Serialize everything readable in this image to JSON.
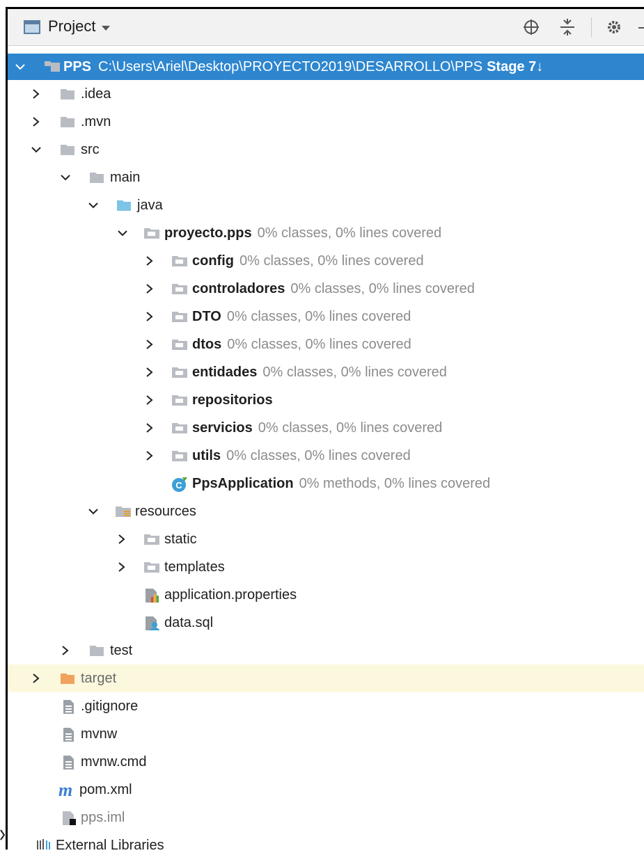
{
  "panel": {
    "title": "Project",
    "icons": [
      "locate-icon",
      "collapse-all-icon",
      "gear-icon",
      "minimize-icon"
    ]
  },
  "tree": {
    "root": {
      "name": "PPS",
      "path": "C:\\Users\\Ariel\\Desktop\\PROYECTO2019\\DESARROLLO\\PPS",
      "stage": "Stage 7↓"
    },
    "items": [
      {
        "name": ".idea",
        "meta": ""
      },
      {
        "name": ".mvn",
        "meta": ""
      },
      {
        "name": "src",
        "meta": ""
      },
      {
        "name": "main",
        "meta": ""
      },
      {
        "name": "java",
        "meta": ""
      },
      {
        "name": "proyecto.pps",
        "meta": "0% classes, 0% lines covered"
      },
      {
        "name": "config",
        "meta": "0% classes, 0% lines covered"
      },
      {
        "name": "controladores",
        "meta": "0% classes, 0% lines covered"
      },
      {
        "name": "DTO",
        "meta": "0% classes, 0% lines covered"
      },
      {
        "name": "dtos",
        "meta": "0% classes, 0% lines covered"
      },
      {
        "name": "entidades",
        "meta": "0% classes, 0% lines covered"
      },
      {
        "name": "repositorios",
        "meta": ""
      },
      {
        "name": "servicios",
        "meta": "0% classes, 0% lines covered"
      },
      {
        "name": "utils",
        "meta": "0% classes, 0% lines covered"
      },
      {
        "name": "PpsApplication",
        "meta": "0% methods, 0% lines covered"
      },
      {
        "name": "resources",
        "meta": ""
      },
      {
        "name": "static",
        "meta": ""
      },
      {
        "name": "templates",
        "meta": ""
      },
      {
        "name": "application.properties",
        "meta": ""
      },
      {
        "name": "data.sql",
        "meta": ""
      },
      {
        "name": "test",
        "meta": ""
      },
      {
        "name": "target",
        "meta": ""
      },
      {
        "name": ".gitignore",
        "meta": ""
      },
      {
        "name": "mvnw",
        "meta": ""
      },
      {
        "name": "mvnw.cmd",
        "meta": ""
      },
      {
        "name": "pom.xml",
        "meta": ""
      },
      {
        "name": "pps.iml",
        "meta": ""
      },
      {
        "name": "External Libraries",
        "meta": ""
      }
    ]
  },
  "colors": {
    "selection": "#2e86cf",
    "folder": "#b9bdc3",
    "source_folder": "#7ec4e8",
    "excluded_folder": "#f0a35e",
    "highlight_row": "#fbf8de",
    "coverage_text": "#8c8c8c"
  }
}
